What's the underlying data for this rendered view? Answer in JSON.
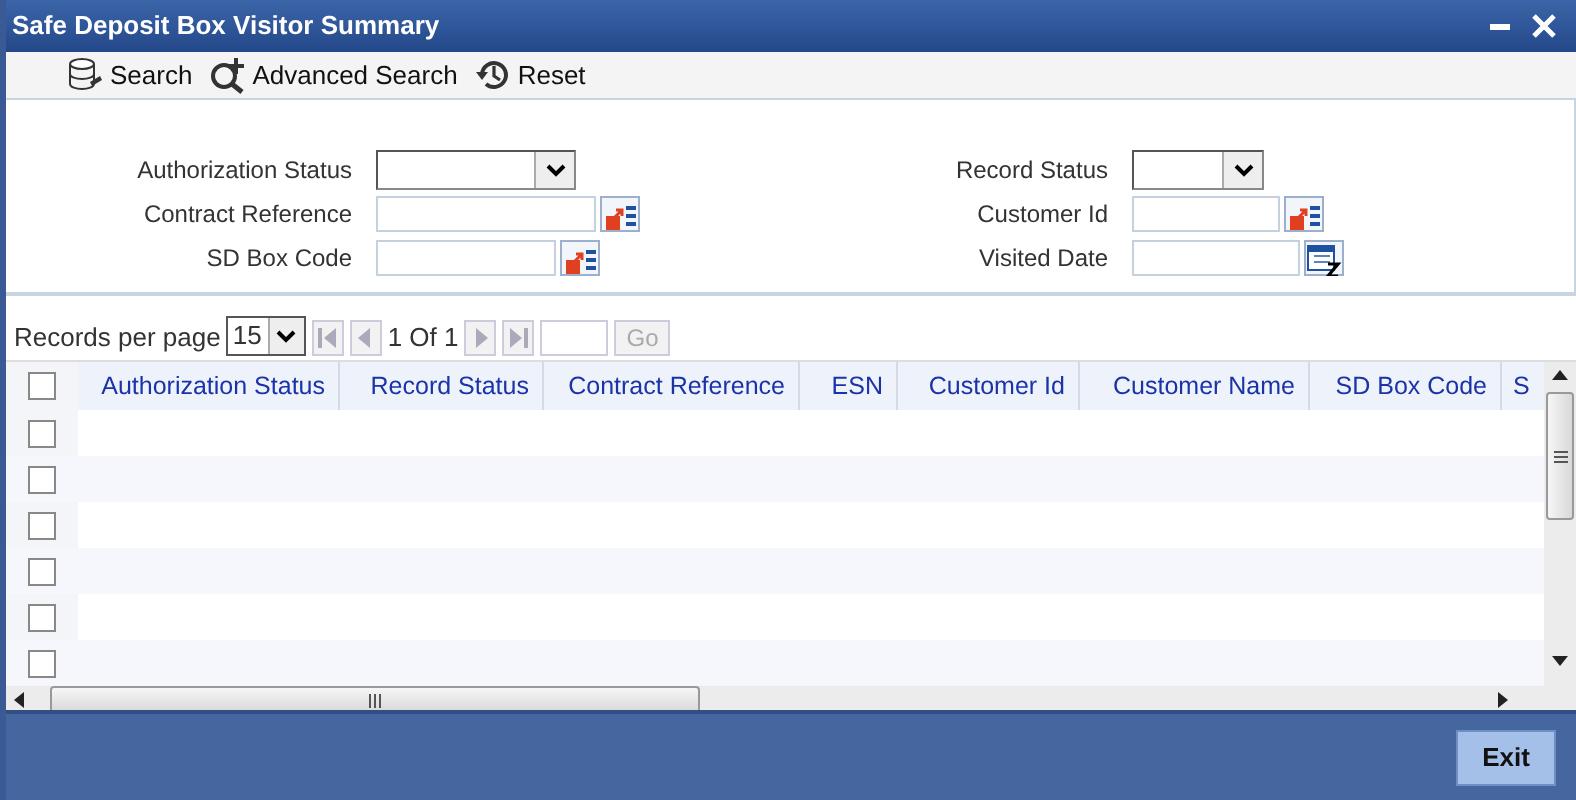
{
  "window": {
    "title": "Safe Deposit Box Visitor Summary"
  },
  "toolbar": [
    {
      "kind": "search",
      "label": "Search"
    },
    {
      "kind": "advanced",
      "label": "Advanced Search"
    },
    {
      "kind": "reset",
      "label": "Reset"
    }
  ],
  "form": {
    "left": [
      {
        "kind": "select",
        "label": "Authorization Status"
      },
      {
        "kind": "lov",
        "label": "Contract Reference"
      },
      {
        "kind": "lov",
        "label": "SD Box Code"
      }
    ],
    "right": [
      {
        "kind": "select",
        "label": "Record Status"
      },
      {
        "kind": "lov",
        "label": "Customer Id"
      },
      {
        "kind": "date",
        "label": "Visited Date"
      }
    ]
  },
  "pager": {
    "label": "Records per page",
    "per_page": "15",
    "page_info": "1 Of 1",
    "go": {
      "label": "Go",
      "disabled": true
    }
  },
  "table": {
    "header_checked": false,
    "columns": [
      "Authorization Status",
      "Record Status",
      "Contract Reference",
      "ESN",
      "Customer Id",
      "Customer Name",
      "SD Box Code",
      "S"
    ],
    "rows": [
      {
        "checked": false
      },
      {
        "checked": false
      },
      {
        "checked": false
      },
      {
        "checked": false
      },
      {
        "checked": false
      },
      {
        "checked": false
      }
    ]
  },
  "footer": {
    "buttons": [
      "Exit"
    ]
  }
}
